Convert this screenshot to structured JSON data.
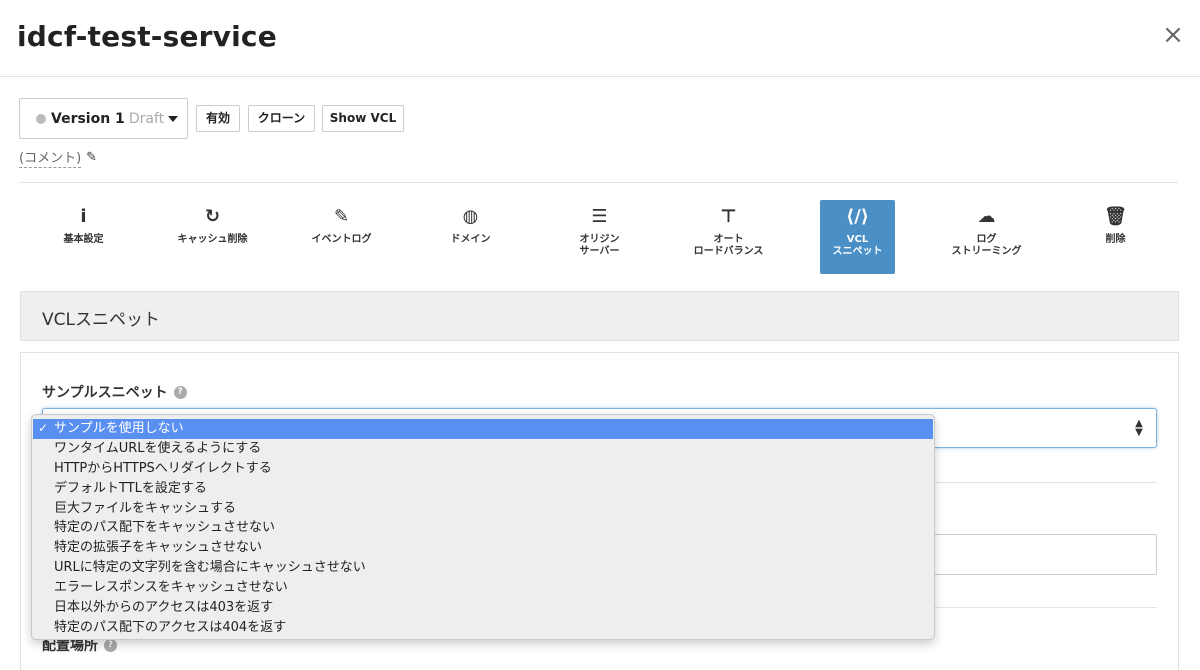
{
  "header": {
    "title": "idcf-test-service",
    "close_icon": "×"
  },
  "toolbar": {
    "version_label": "Version 1",
    "version_status": "Draft",
    "activate_label": "有効",
    "clone_label": "クローン",
    "show_vcl_label": "Show VCL",
    "comment_label": "(コメント)"
  },
  "nav": {
    "items": [
      {
        "label": "基本設定",
        "icon": "info-icon",
        "glyph": "i"
      },
      {
        "label": "キャッシュ削除",
        "icon": "refresh-icon",
        "glyph": "↻"
      },
      {
        "label": "イベントログ",
        "icon": "edit-log-icon",
        "glyph": "✎"
      },
      {
        "label": "ドメイン",
        "icon": "globe-icon",
        "glyph": "◍"
      },
      {
        "label": "オリジン\nサーバー",
        "icon": "server-icon",
        "glyph": "☰"
      },
      {
        "label": "オート\nロードバランス",
        "icon": "sitemap-icon",
        "glyph": "⊤"
      },
      {
        "label": "VCL\nスニペット",
        "icon": "code-file-icon",
        "glyph": "⟨/⟩"
      },
      {
        "label": "ログ\nストリーミング",
        "icon": "cloud-download-icon",
        "glyph": "☁"
      },
      {
        "label": "削除",
        "icon": "trash-icon",
        "glyph": "🗑"
      }
    ],
    "active_index": 6,
    "active_color": "#4a90c7"
  },
  "section": {
    "title": "VCLスニペット"
  },
  "form": {
    "sample_label": "サンプルスニペット",
    "placement_label": "配置場所",
    "options": [
      "サンプルを使用しない",
      "ワンタイムURLを使えるようにする",
      "HTTPからHTTPSへリダイレクトする",
      "デフォルトTTLを設定する",
      "巨大ファイルをキャッシュする",
      "特定のパス配下をキャッシュさせない",
      "特定の拡張子をキャッシュさせない",
      "URLに特定の文字列を含む場合にキャッシュさせない",
      "エラーレスポンスをキャッシュさせない",
      "日本以外からのアクセスは403を返す",
      "特定のパス配下のアクセスは404を返す"
    ],
    "selected_index": 0,
    "selected_color": "#5a8ff2"
  }
}
